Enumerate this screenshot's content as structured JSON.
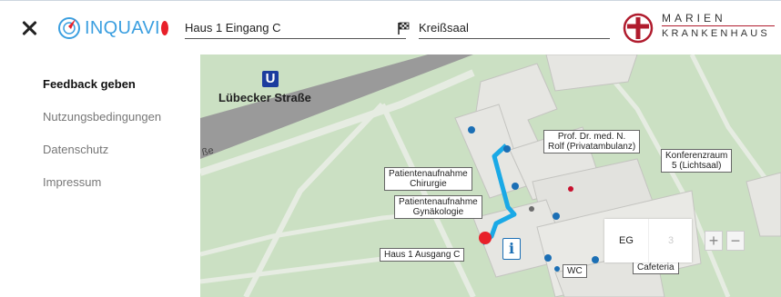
{
  "header": {
    "logo_text": "INQUAVI",
    "start_value": "Haus 1 Eingang C",
    "destination_value": "Kreißsaal",
    "brand_line1": "MARIEN",
    "brand_line2": "KRANKENHAUS"
  },
  "sidebar": {
    "items": [
      {
        "label": "Feedback geben"
      },
      {
        "label": "Nutzungsbedingungen"
      },
      {
        "label": "Datenschutz"
      },
      {
        "label": "Impressum"
      }
    ]
  },
  "map": {
    "station_letter": "U",
    "station_name": "Lübecker Straße",
    "street_fragment": "ße",
    "labels": {
      "rolf": [
        "Prof. Dr. med. N.",
        "Rolf (Privatambulanz)"
      ],
      "konferenz": [
        "Konferenzraum",
        "5 (Lichtsaal)"
      ],
      "chirurgie": [
        "Patientenaufnahme",
        "Chirurgie"
      ],
      "gynaekologie": [
        "Patientenaufnahme",
        "Gynäkologie"
      ],
      "ausgang": "Haus 1 Ausgang C",
      "wc": "WC",
      "cafeteria": "Cafeteria"
    },
    "info_symbol": "i",
    "levels": [
      "EG",
      "3"
    ],
    "active_level": "EG",
    "zoom_in": "+",
    "zoom_out": "−",
    "route_color": "#1aa9e6",
    "position_color": "#e8202a"
  }
}
